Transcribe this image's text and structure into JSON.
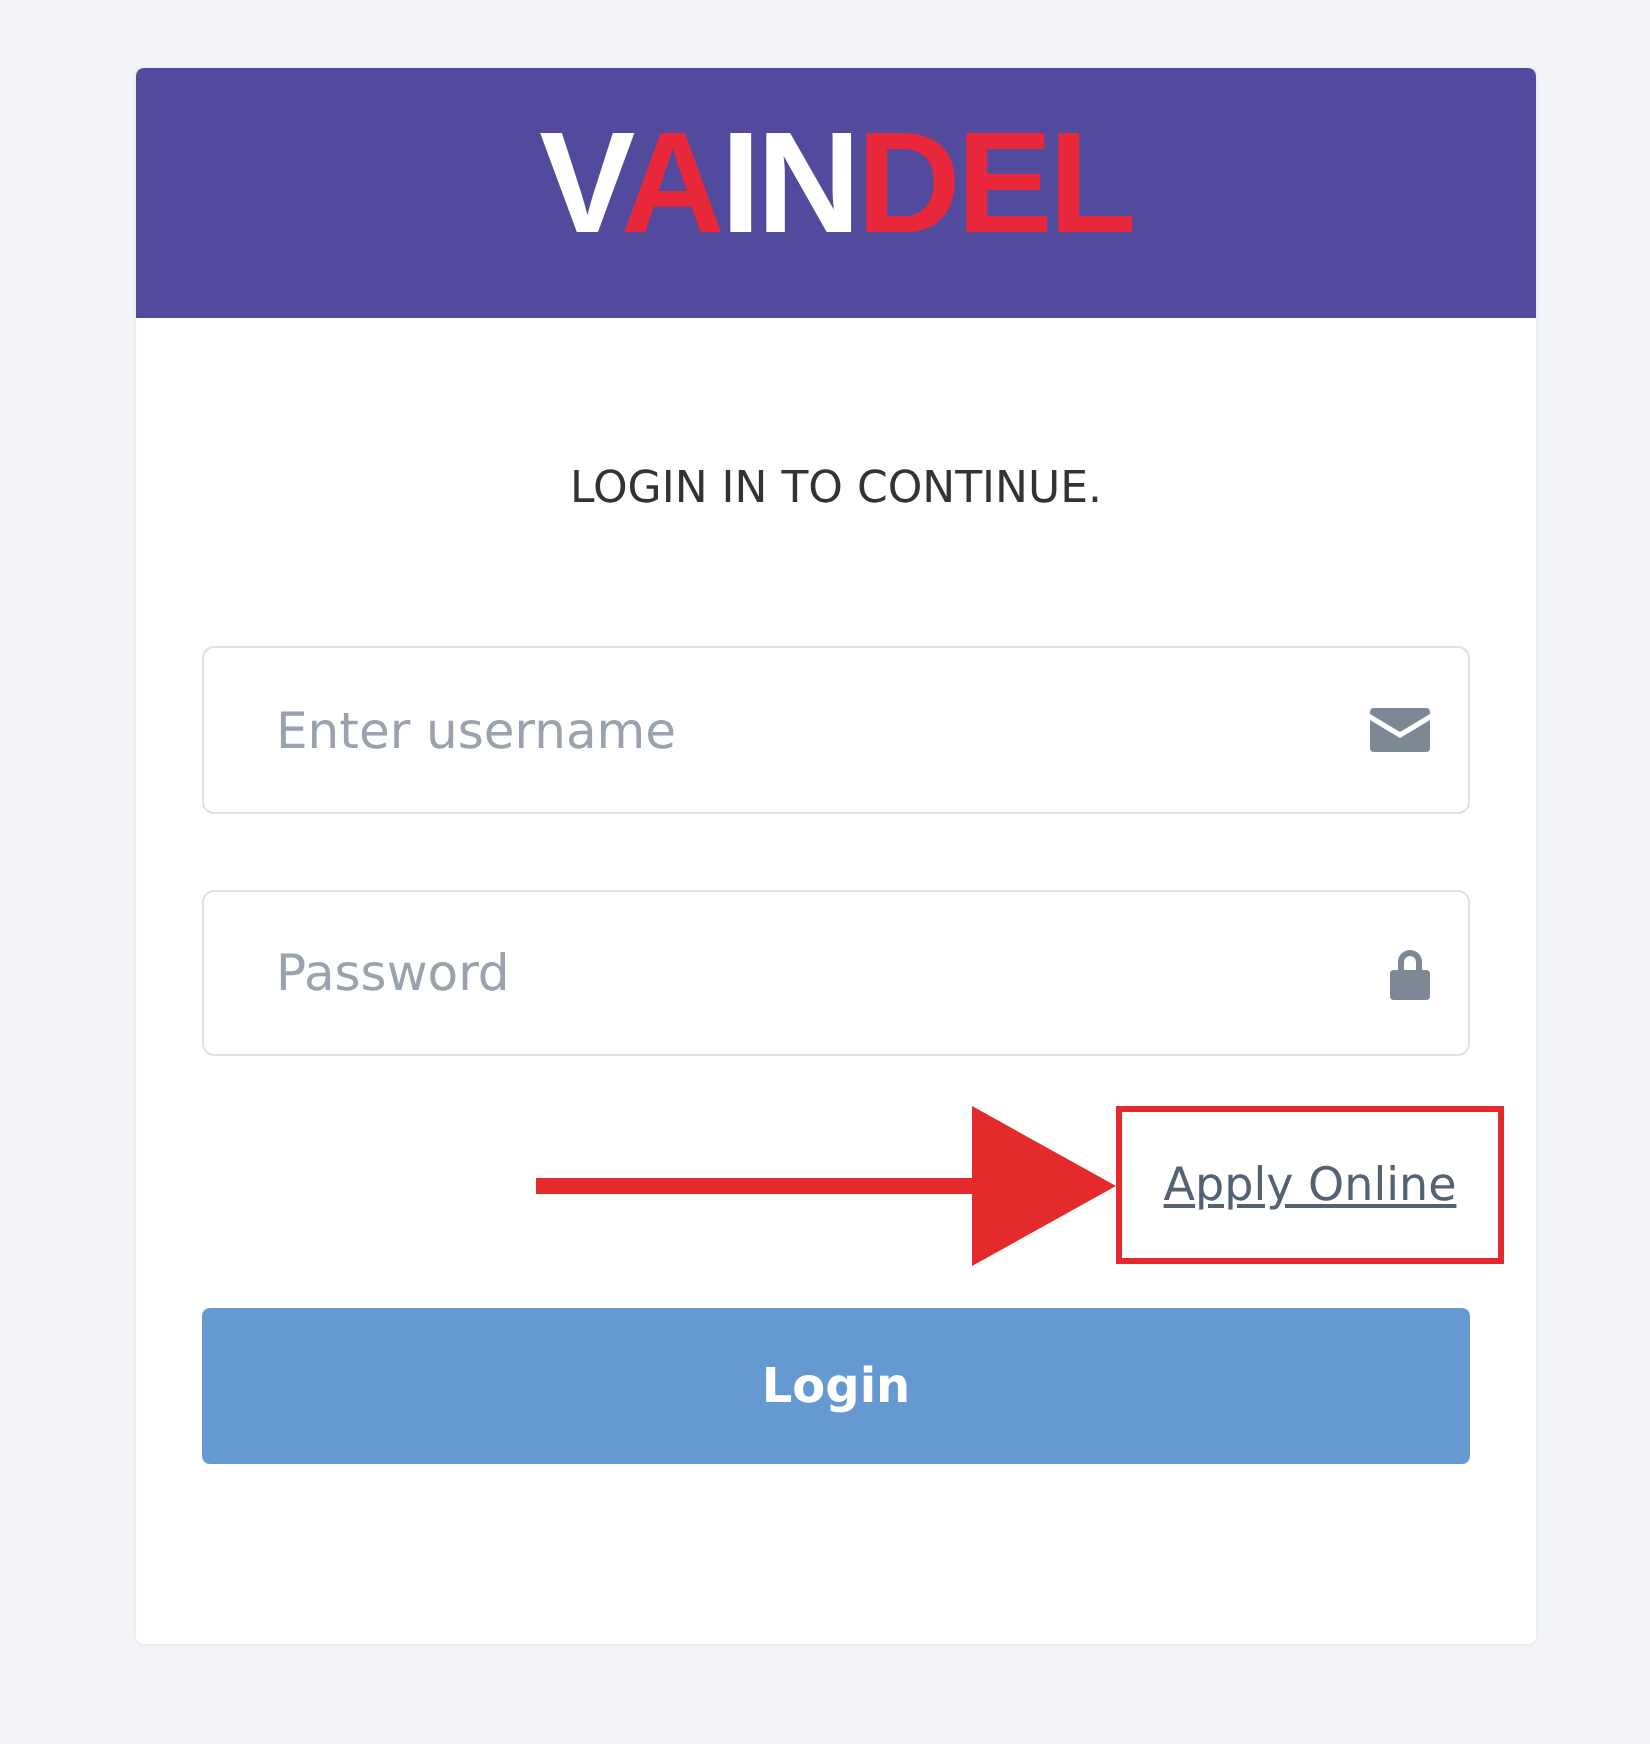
{
  "logo": [
    {
      "text": "V",
      "color": "#ffffff"
    },
    {
      "text": "A",
      "color": "#e8283a"
    },
    {
      "text": "IN",
      "color": "#ffffff"
    },
    {
      "text": "DEL",
      "color": "#e8283a"
    }
  ],
  "heading": "LOGIN IN TO CONTINUE.",
  "fields": [
    {
      "placeholder": "Enter username",
      "kind": "email"
    },
    {
      "placeholder": "Password",
      "kind": "password"
    }
  ],
  "link": {
    "text": "Apply Online",
    "highlighted": true
  },
  "button": "Login"
}
